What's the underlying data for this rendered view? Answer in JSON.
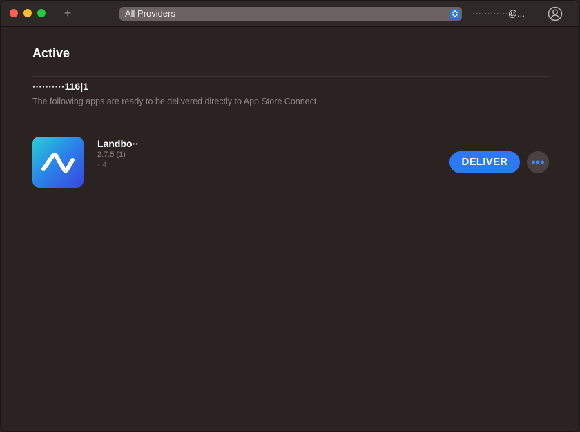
{
  "window": {
    "title_add_label": "+",
    "provider_select": {
      "value": "All Providers"
    },
    "account": {
      "name": "············@..."
    }
  },
  "main": {
    "section_title": "Active",
    "provider": {
      "name": "··········116|1",
      "description": "The following apps are ready to be delivered directly to App Store Connect."
    },
    "apps": [
      {
        "name": "Landbo··",
        "version": "2.7.5 (1)",
        "build": "··4",
        "deliver_label": "DELIVER",
        "more_label": "•••"
      }
    ]
  },
  "colors": {
    "accent": "#2d79f3",
    "background": "#2a2321",
    "close": "#fe5f57",
    "minimize": "#febc2e",
    "maximize": "#28c840"
  },
  "icons": [
    "plus-icon",
    "chevron-updown-icon",
    "account-icon",
    "app-icon",
    "more-icon"
  ]
}
